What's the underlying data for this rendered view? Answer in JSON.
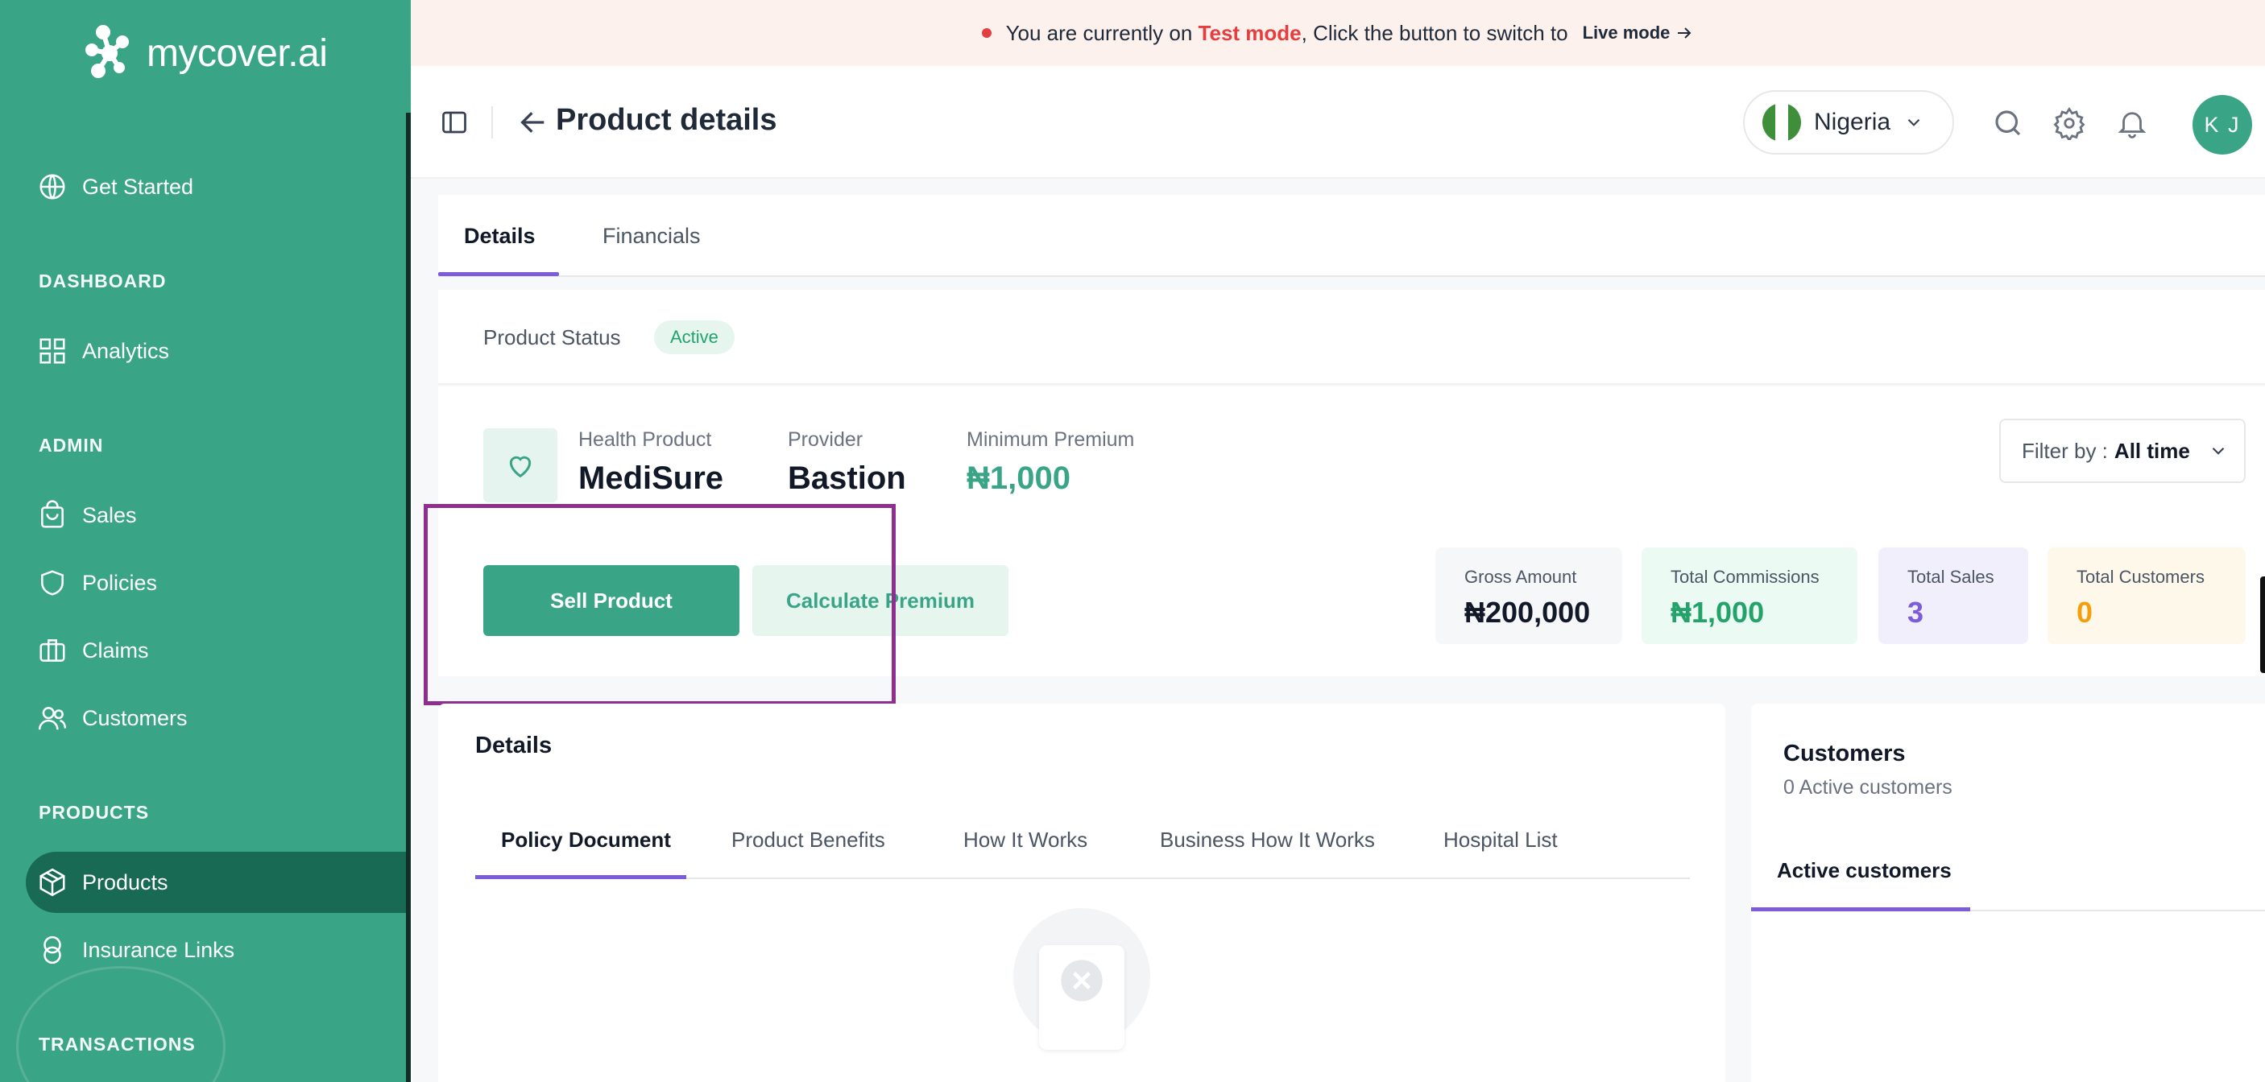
{
  "brand": {
    "name": "mycover.ai",
    "accent": "#3aa487",
    "accent_dark": "#186a55"
  },
  "sidebar": {
    "get_started": "Get Started",
    "sections": {
      "dashboard": "DASHBOARD",
      "admin": "ADMIN",
      "products": "PRODUCTS",
      "transactions": "TRANSACTIONS"
    },
    "items": {
      "analytics": "Analytics",
      "sales": "Sales",
      "policies": "Policies",
      "claims": "Claims",
      "customers": "Customers",
      "products": "Products",
      "insurance_links": "Insurance Links"
    },
    "active_item": "Products"
  },
  "banner": {
    "prefix": "You are currently on ",
    "mode": "Test mode",
    "suffix": ", Click the button to switch to",
    "link": "Live mode",
    "mode_color": "#e53e3e"
  },
  "header": {
    "title": "Product details",
    "country": "Nigeria",
    "avatar_initials": "K J",
    "icons": [
      "sidebar-toggle-icon",
      "back-arrow-icon",
      "search-icon",
      "gear-icon",
      "bell-icon"
    ]
  },
  "tabs": [
    {
      "label": "Details",
      "active": true
    },
    {
      "label": "Financials",
      "active": false
    }
  ],
  "status": {
    "label": "Product Status",
    "badge": "Active"
  },
  "product": {
    "type_label": "Health Product",
    "name": "MediSure",
    "provider_label": "Provider",
    "provider": "Bastion",
    "min_premium_label": "Minimum Premium",
    "min_premium": "₦1,000"
  },
  "filter": {
    "label": "Filter by :",
    "value": "All time"
  },
  "actions": {
    "sell": "Sell Product",
    "calculate": "Calculate Premium"
  },
  "stats": [
    {
      "label": "Gross Amount",
      "value": "₦200,000",
      "color": "#111827",
      "bg": "#f6f7f8"
    },
    {
      "label": "Total Commissions",
      "value": "₦1,000",
      "color": "#23a36b",
      "bg": "#ebfaf2"
    },
    {
      "label": "Total Sales",
      "value": "3",
      "color": "#7c5cdb",
      "bg": "#f1effc"
    },
    {
      "label": "Total Customers",
      "value": "0",
      "color": "#f59e0b",
      "bg": "#fef8ea"
    }
  ],
  "details": {
    "title": "Details",
    "tabs": [
      "Policy Document",
      "Product Benefits",
      "How It Works",
      "Business How It Works",
      "Hospital List"
    ],
    "active_tab": "Policy Document"
  },
  "customers": {
    "title": "Customers",
    "subtitle": "0 Active customers",
    "tab": "Active customers"
  }
}
